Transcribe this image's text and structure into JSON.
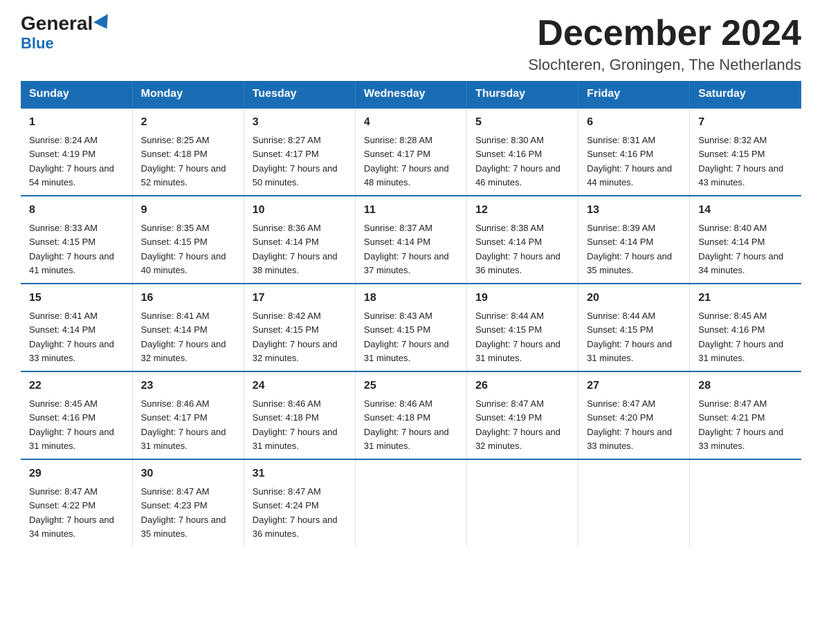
{
  "logo": {
    "general": "General",
    "blue": "Blue",
    "triangle": true
  },
  "title": "December 2024",
  "subtitle": "Slochteren, Groningen, The Netherlands",
  "header_days": [
    "Sunday",
    "Monday",
    "Tuesday",
    "Wednesday",
    "Thursday",
    "Friday",
    "Saturday"
  ],
  "weeks": [
    [
      {
        "day": "1",
        "sunrise": "8:24 AM",
        "sunset": "4:19 PM",
        "daylight": "7 hours and 54 minutes."
      },
      {
        "day": "2",
        "sunrise": "8:25 AM",
        "sunset": "4:18 PM",
        "daylight": "7 hours and 52 minutes."
      },
      {
        "day": "3",
        "sunrise": "8:27 AM",
        "sunset": "4:17 PM",
        "daylight": "7 hours and 50 minutes."
      },
      {
        "day": "4",
        "sunrise": "8:28 AM",
        "sunset": "4:17 PM",
        "daylight": "7 hours and 48 minutes."
      },
      {
        "day": "5",
        "sunrise": "8:30 AM",
        "sunset": "4:16 PM",
        "daylight": "7 hours and 46 minutes."
      },
      {
        "day": "6",
        "sunrise": "8:31 AM",
        "sunset": "4:16 PM",
        "daylight": "7 hours and 44 minutes."
      },
      {
        "day": "7",
        "sunrise": "8:32 AM",
        "sunset": "4:15 PM",
        "daylight": "7 hours and 43 minutes."
      }
    ],
    [
      {
        "day": "8",
        "sunrise": "8:33 AM",
        "sunset": "4:15 PM",
        "daylight": "7 hours and 41 minutes."
      },
      {
        "day": "9",
        "sunrise": "8:35 AM",
        "sunset": "4:15 PM",
        "daylight": "7 hours and 40 minutes."
      },
      {
        "day": "10",
        "sunrise": "8:36 AM",
        "sunset": "4:14 PM",
        "daylight": "7 hours and 38 minutes."
      },
      {
        "day": "11",
        "sunrise": "8:37 AM",
        "sunset": "4:14 PM",
        "daylight": "7 hours and 37 minutes."
      },
      {
        "day": "12",
        "sunrise": "8:38 AM",
        "sunset": "4:14 PM",
        "daylight": "7 hours and 36 minutes."
      },
      {
        "day": "13",
        "sunrise": "8:39 AM",
        "sunset": "4:14 PM",
        "daylight": "7 hours and 35 minutes."
      },
      {
        "day": "14",
        "sunrise": "8:40 AM",
        "sunset": "4:14 PM",
        "daylight": "7 hours and 34 minutes."
      }
    ],
    [
      {
        "day": "15",
        "sunrise": "8:41 AM",
        "sunset": "4:14 PM",
        "daylight": "7 hours and 33 minutes."
      },
      {
        "day": "16",
        "sunrise": "8:41 AM",
        "sunset": "4:14 PM",
        "daylight": "7 hours and 32 minutes."
      },
      {
        "day": "17",
        "sunrise": "8:42 AM",
        "sunset": "4:15 PM",
        "daylight": "7 hours and 32 minutes."
      },
      {
        "day": "18",
        "sunrise": "8:43 AM",
        "sunset": "4:15 PM",
        "daylight": "7 hours and 31 minutes."
      },
      {
        "day": "19",
        "sunrise": "8:44 AM",
        "sunset": "4:15 PM",
        "daylight": "7 hours and 31 minutes."
      },
      {
        "day": "20",
        "sunrise": "8:44 AM",
        "sunset": "4:15 PM",
        "daylight": "7 hours and 31 minutes."
      },
      {
        "day": "21",
        "sunrise": "8:45 AM",
        "sunset": "4:16 PM",
        "daylight": "7 hours and 31 minutes."
      }
    ],
    [
      {
        "day": "22",
        "sunrise": "8:45 AM",
        "sunset": "4:16 PM",
        "daylight": "7 hours and 31 minutes."
      },
      {
        "day": "23",
        "sunrise": "8:46 AM",
        "sunset": "4:17 PM",
        "daylight": "7 hours and 31 minutes."
      },
      {
        "day": "24",
        "sunrise": "8:46 AM",
        "sunset": "4:18 PM",
        "daylight": "7 hours and 31 minutes."
      },
      {
        "day": "25",
        "sunrise": "8:46 AM",
        "sunset": "4:18 PM",
        "daylight": "7 hours and 31 minutes."
      },
      {
        "day": "26",
        "sunrise": "8:47 AM",
        "sunset": "4:19 PM",
        "daylight": "7 hours and 32 minutes."
      },
      {
        "day": "27",
        "sunrise": "8:47 AM",
        "sunset": "4:20 PM",
        "daylight": "7 hours and 33 minutes."
      },
      {
        "day": "28",
        "sunrise": "8:47 AM",
        "sunset": "4:21 PM",
        "daylight": "7 hours and 33 minutes."
      }
    ],
    [
      {
        "day": "29",
        "sunrise": "8:47 AM",
        "sunset": "4:22 PM",
        "daylight": "7 hours and 34 minutes."
      },
      {
        "day": "30",
        "sunrise": "8:47 AM",
        "sunset": "4:23 PM",
        "daylight": "7 hours and 35 minutes."
      },
      {
        "day": "31",
        "sunrise": "8:47 AM",
        "sunset": "4:24 PM",
        "daylight": "7 hours and 36 minutes."
      },
      null,
      null,
      null,
      null
    ]
  ]
}
